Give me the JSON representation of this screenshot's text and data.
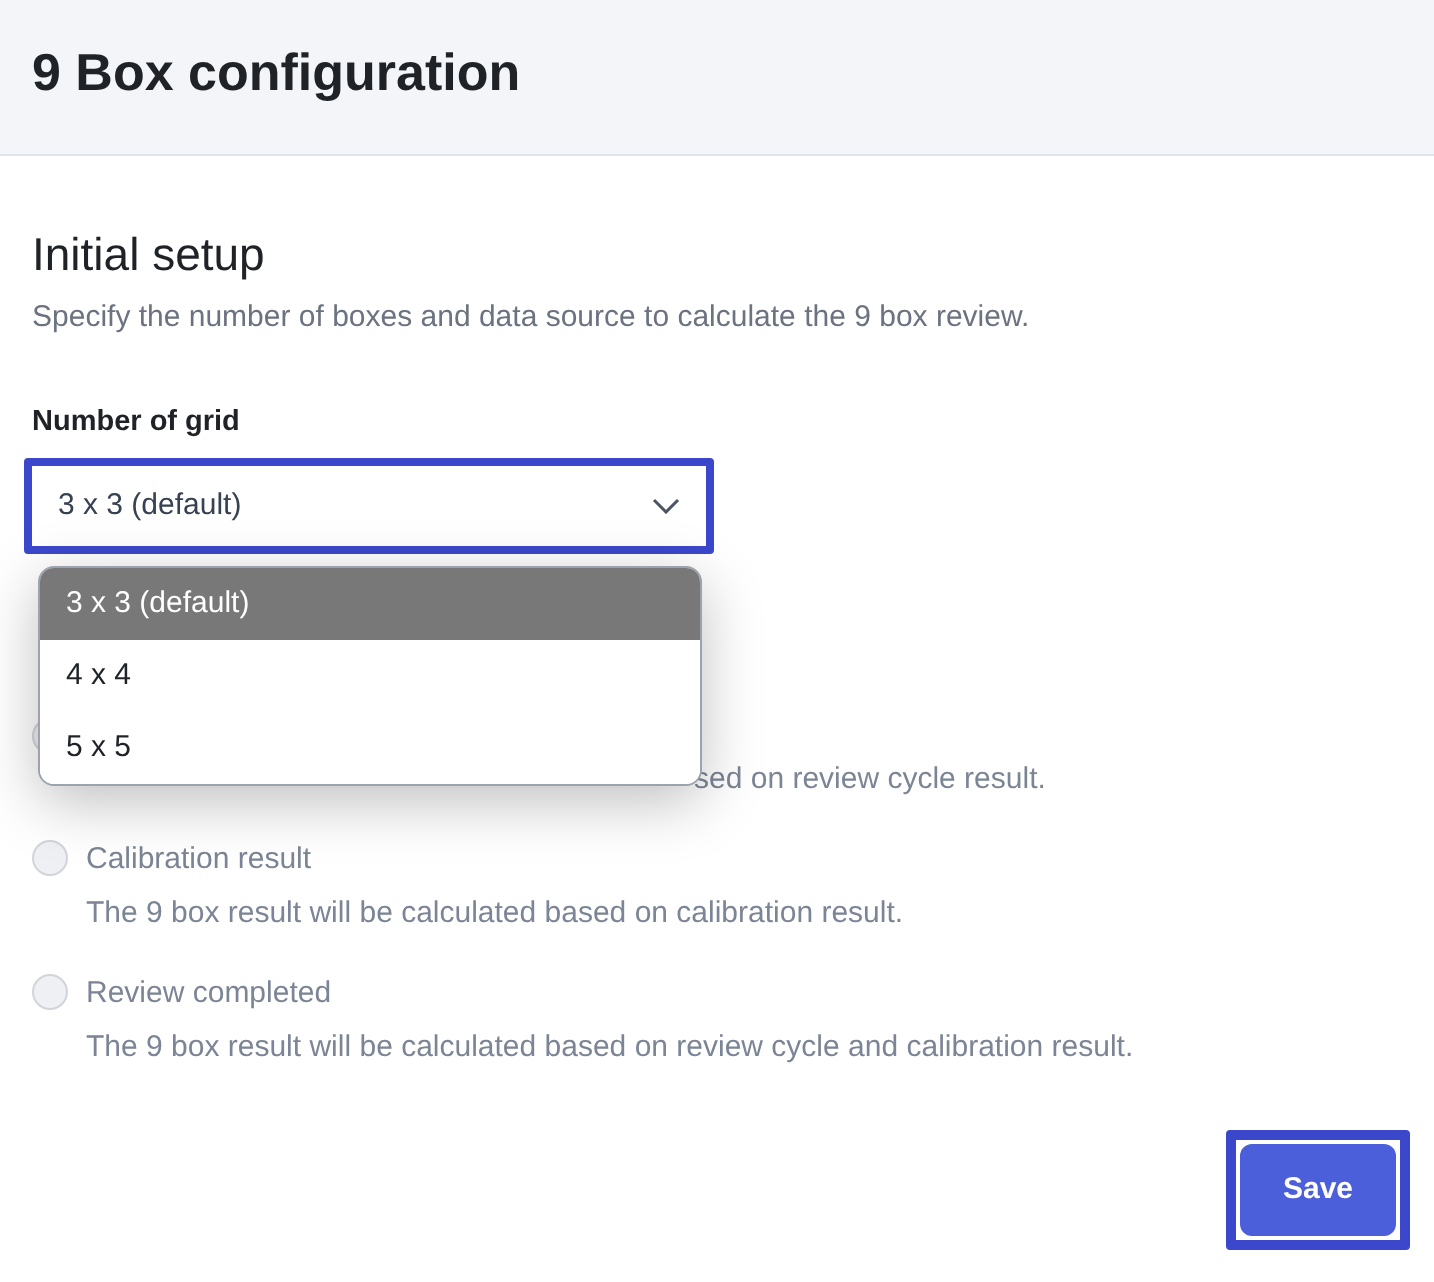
{
  "header": {
    "title": "9 Box configuration"
  },
  "section": {
    "title": "Initial setup",
    "subtitle": "Specify the number of boxes and data source to calculate the 9 box review."
  },
  "grid_select": {
    "label": "Number of grid",
    "value": "3 x 3 (default)",
    "expanded": true,
    "options": [
      {
        "label": "3 x 3 (default)",
        "selected": true
      },
      {
        "label": "4 x 4",
        "selected": false
      },
      {
        "label": "5 x 5",
        "selected": false
      }
    ]
  },
  "data_source": {
    "options": [
      {
        "kind": "covered",
        "description": "sed on review cycle result.",
        "selected": false
      },
      {
        "kind": "full",
        "label": "Calibration result",
        "description": "The 9 box result will be calculated based on calibration result.",
        "selected": false
      },
      {
        "kind": "full",
        "label": "Review completed",
        "description": "The 9 box result will be calculated based on review cycle and calibration result.",
        "selected": false
      }
    ]
  },
  "save_button": "Save"
}
